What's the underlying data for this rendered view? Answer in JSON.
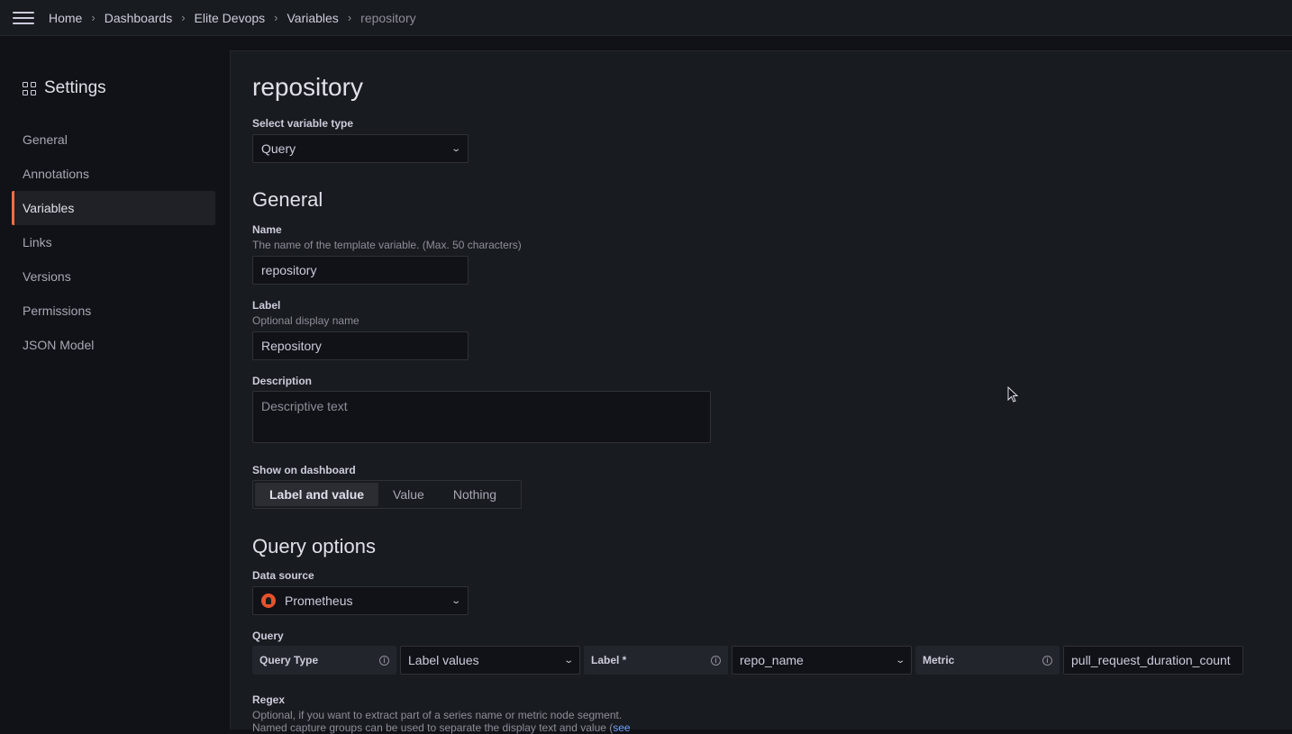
{
  "breadcrumb": [
    "Home",
    "Dashboards",
    "Elite Devops",
    "Variables",
    "repository"
  ],
  "sidebar": {
    "title": "Settings",
    "items": [
      {
        "label": "General",
        "active": false
      },
      {
        "label": "Annotations",
        "active": false
      },
      {
        "label": "Variables",
        "active": true
      },
      {
        "label": "Links",
        "active": false
      },
      {
        "label": "Versions",
        "active": false
      },
      {
        "label": "Permissions",
        "active": false
      },
      {
        "label": "JSON Model",
        "active": false
      }
    ]
  },
  "page": {
    "title": "repository",
    "variable_type_label": "Select variable type",
    "variable_type_value": "Query"
  },
  "general": {
    "heading": "General",
    "name_label": "Name",
    "name_desc": "The name of the template variable. (Max. 50 characters)",
    "name_value": "repository",
    "label_label": "Label",
    "label_desc": "Optional display name",
    "label_value": "Repository",
    "description_label": "Description",
    "description_placeholder": "Descriptive text",
    "show_label": "Show on dashboard",
    "show_options": [
      "Label and value",
      "Value",
      "Nothing"
    ],
    "show_selected": "Label and value"
  },
  "query_options": {
    "heading": "Query options",
    "datasource_label": "Data source",
    "datasource_value": "Prometheus",
    "query_label": "Query",
    "query_type_label": "Query Type",
    "query_type_value": "Label values",
    "label_field_label": "Label *",
    "label_field_value": "repo_name",
    "metric_label": "Metric",
    "metric_value": "pull_request_duration_count",
    "regex_label": "Regex",
    "regex_desc_1": "Optional, if you want to extract part of a series name or metric node segment.",
    "regex_desc_2": "Named capture groups can be used to separate the display text and value (",
    "regex_link": "see"
  },
  "colors": {
    "accent": "#f46e43",
    "background": "#111217",
    "panel": "#181b1f",
    "prometheus": "#e6522c"
  }
}
